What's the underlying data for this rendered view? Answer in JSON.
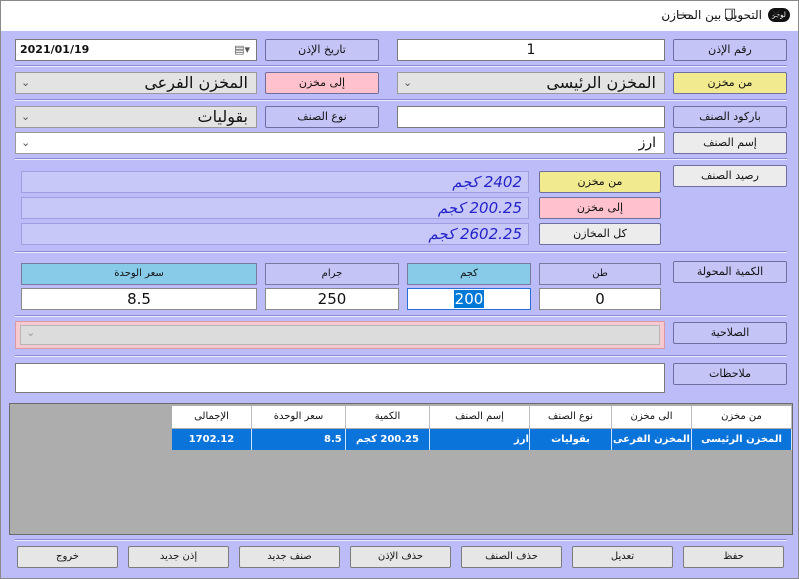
{
  "window": {
    "title": "التحويل بين المخازن",
    "icon_text": "لوجو",
    "min": "—",
    "max": "☐",
    "close": "✕"
  },
  "form": {
    "voucher_no_label": "رقم الإذن",
    "voucher_no": "1",
    "voucher_date_label": "تاريخ الإذن",
    "voucher_date": "2021/01/19",
    "from_store_label": "من مخزن",
    "from_store": "المخزن الرئيسى",
    "to_store_label": "إلى مخزن",
    "to_store": "المخزن الفرعى",
    "barcode_label": "باركود الصنف",
    "barcode": "",
    "item_type_label": "نوع الصنف",
    "item_type": "بقوليات",
    "item_name_label": "إسم الصنف",
    "item_name": "ارز",
    "balance_label": "رصيد الصنف",
    "bal_from_label": "من مخزن",
    "bal_from": "2402 كجم",
    "bal_to_label": "إلى مخزن",
    "bal_to": "200.25 كجم",
    "bal_all_label": "كل المخازن",
    "bal_all": "2602.25 كجم",
    "transfer_qty_label": "الكمية المحولة",
    "col_ton": "طن",
    "col_kg": "كجم",
    "col_gram": "جرام",
    "col_unit_price": "سعر الوحدة",
    "val_ton": "0",
    "val_kg": "200",
    "val_gram": "250",
    "val_unit_price": "8.5",
    "validity_label": "الصلاحية",
    "notes_label": "ملاحظات",
    "notes": ""
  },
  "table": {
    "headers": [
      "من مخزن",
      "الى مخزن",
      "نوع الصنف",
      "إسم الصنف",
      "الكمية",
      "سعر الوحدة",
      "الإجمالى"
    ],
    "rows": [
      [
        "المخزن الرئيسى",
        "المخزن الفرعى",
        "بقوليات",
        "ارز",
        "200.25 كجم",
        "8.5",
        "1702.12"
      ]
    ]
  },
  "buttons": [
    "حفظ",
    "تعديل",
    "حذف الصنف",
    "حذف الإذن",
    "صنف جديد",
    "إذن جديد",
    "خروج"
  ]
}
